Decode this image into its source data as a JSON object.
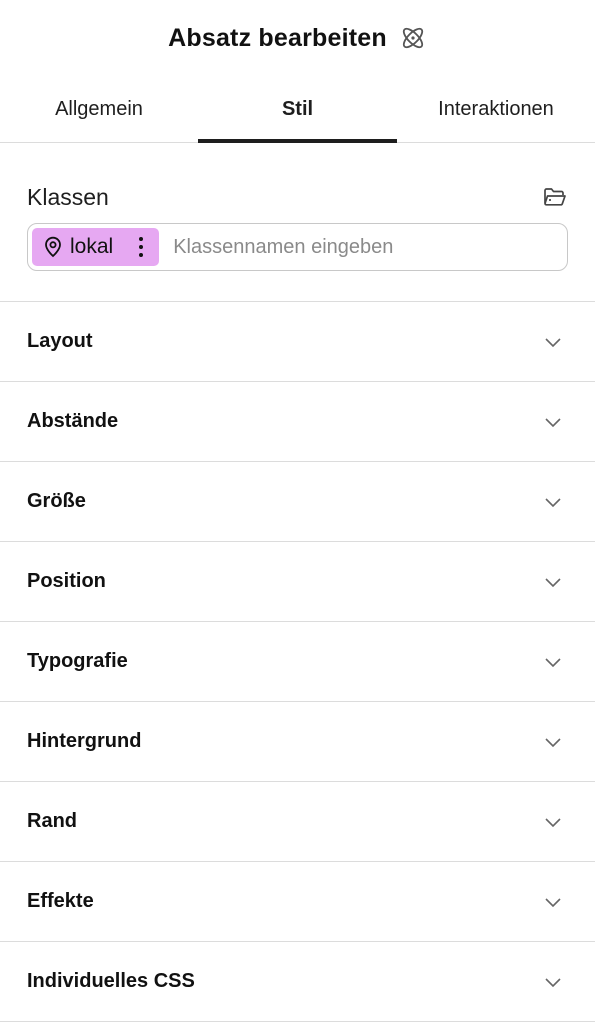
{
  "header": {
    "title": "Absatz bearbeiten",
    "icon": "atom-icon"
  },
  "tabs": [
    {
      "label": "Allgemein",
      "active": false
    },
    {
      "label": "Stil",
      "active": true
    },
    {
      "label": "Interaktionen",
      "active": false
    }
  ],
  "classes": {
    "label": "Klassen",
    "library_icon": "folder-open-icon",
    "chip": {
      "label": "lokal",
      "color": "#e6a8f2",
      "icon": "map-pin-icon",
      "menu_icon": "vertical-dots-icon"
    },
    "input": {
      "value": "",
      "placeholder": "Klassennamen eingeben"
    }
  },
  "sections": [
    {
      "label": "Layout"
    },
    {
      "label": "Abstände"
    },
    {
      "label": "Größe"
    },
    {
      "label": "Position"
    },
    {
      "label": "Typografie"
    },
    {
      "label": "Hintergrund"
    },
    {
      "label": "Rand"
    },
    {
      "label": "Effekte"
    },
    {
      "label": "Individuelles CSS"
    }
  ],
  "colors": {
    "accent_chip": "#e6a8f2",
    "divider": "#dcdcdc",
    "text": "#1e1e1e"
  }
}
